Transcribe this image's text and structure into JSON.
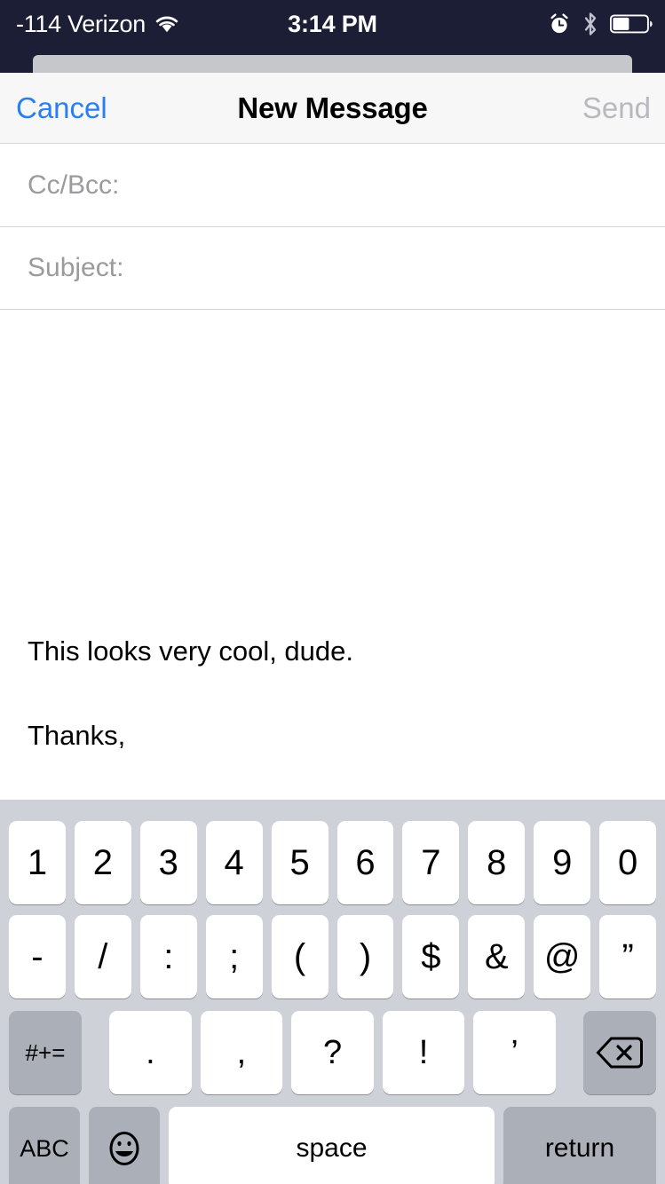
{
  "status_bar": {
    "carrier": "-114 Verizon",
    "wifi_icon": "wifi-icon",
    "time": "3:14 PM",
    "alarm_icon": "alarm-clock-icon",
    "bluetooth_icon": "bluetooth-icon",
    "battery_icon": "battery-icon",
    "battery_level_percent": 48,
    "background_color": "#1c1e36",
    "text_color": "#ffffff"
  },
  "nav_bar": {
    "cancel_label": "Cancel",
    "title": "New Message",
    "send_label": "Send",
    "cancel_color": "#2a7ff0",
    "send_color": "#b9b9bd",
    "background_color": "#f7f7f8"
  },
  "compose": {
    "fields": [
      {
        "name": "cc-bcc",
        "label": "Cc/Bcc:"
      },
      {
        "name": "subject",
        "label": "Subject:"
      }
    ],
    "body": {
      "line1": "This looks very cool, dude.",
      "line2": "Thanks,",
      "attachment_name": "handwritten-signature-drawing",
      "text_color": "#000000"
    },
    "placeholder_color": "#9a9a9f"
  },
  "keyboard": {
    "type": "numeric-symbols",
    "background_color": "#ced1d8",
    "key_color": "#ffffff",
    "modifier_key_color": "#abafb8",
    "row1": [
      "1",
      "2",
      "3",
      "4",
      "5",
      "6",
      "7",
      "8",
      "9",
      "0"
    ],
    "row2": [
      "-",
      "/",
      ":",
      ";",
      "(",
      ")",
      "$",
      "&",
      "@",
      "”"
    ],
    "row3": {
      "modifier_label": "#+=",
      "keys": [
        ".",
        ",",
        "?",
        "!",
        "’"
      ],
      "backspace_icon": "backspace-delete-icon"
    },
    "row4": {
      "abc_label": "ABC",
      "emoji_icon": "emoji-smiley-icon",
      "space_label": "space",
      "return_label": "return"
    }
  }
}
